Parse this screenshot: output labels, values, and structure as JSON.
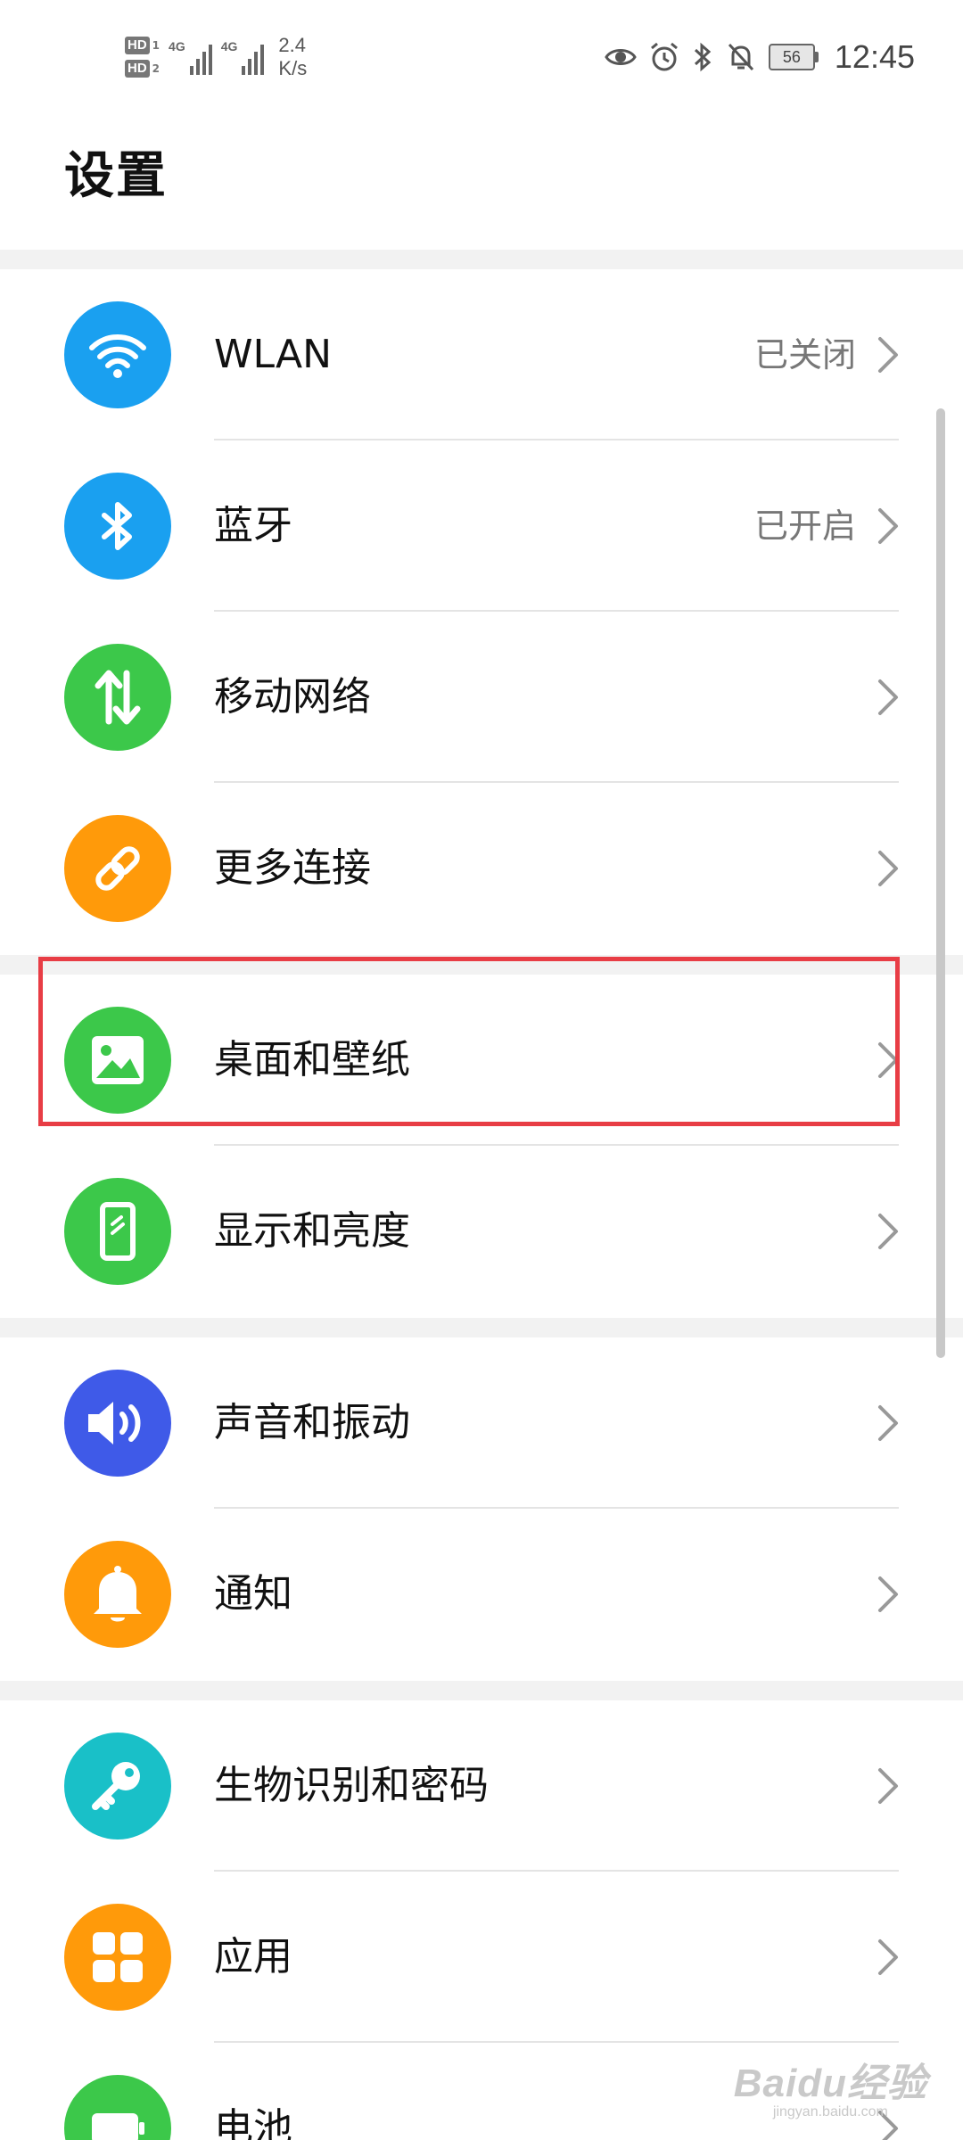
{
  "status_bar": {
    "hd1": "HD",
    "hd1_index": "1",
    "hd2": "HD",
    "hd2_index": "2",
    "network1": "4G",
    "network2": "4G",
    "speed_value": "2.4",
    "speed_unit": "K/s",
    "battery_level": "56",
    "time": "12:45",
    "icons": [
      "eye-icon",
      "alarm-icon",
      "bluetooth-icon",
      "bell-off-icon",
      "battery-icon"
    ]
  },
  "page": {
    "title": "设置"
  },
  "settings": [
    {
      "key": "wlan",
      "label": "WLAN",
      "value": "已关闭",
      "icon": "wifi-icon",
      "color": "#1aa0f0"
    },
    {
      "key": "bluetooth",
      "label": "蓝牙",
      "value": "已开启",
      "icon": "bluetooth-icon",
      "color": "#1aa0f0"
    },
    {
      "key": "mobile-network",
      "label": "移动网络",
      "value": "",
      "icon": "data-arrows-icon",
      "color": "#3cc84a"
    },
    {
      "key": "more-connections",
      "label": "更多连接",
      "value": "",
      "icon": "link-icon",
      "color": "#ff9a0a"
    },
    {
      "key": "home-wallpaper",
      "label": "桌面和壁纸",
      "value": "",
      "icon": "image-icon",
      "color": "#3cc84a"
    },
    {
      "key": "display-brightness",
      "label": "显示和亮度",
      "value": "",
      "icon": "phone-display-icon",
      "color": "#3cc84a"
    },
    {
      "key": "sound-vibration",
      "label": "声音和振动",
      "value": "",
      "icon": "speaker-icon",
      "color": "#3f5ae8"
    },
    {
      "key": "notifications",
      "label": "通知",
      "value": "",
      "icon": "bell-icon",
      "color": "#ff9a0a"
    },
    {
      "key": "biometrics-password",
      "label": "生物识别和密码",
      "value": "",
      "icon": "key-icon",
      "color": "#19c0c8"
    },
    {
      "key": "apps",
      "label": "应用",
      "value": "",
      "icon": "apps-grid-icon",
      "color": "#ff9a0a"
    },
    {
      "key": "battery",
      "label": "电池",
      "value": "",
      "icon": "battery-icon",
      "color": "#3cc84a"
    }
  ],
  "highlight_color": "#e83d45",
  "watermark": {
    "logo": "Baidu经验",
    "url": "jingyan.baidu.com"
  }
}
